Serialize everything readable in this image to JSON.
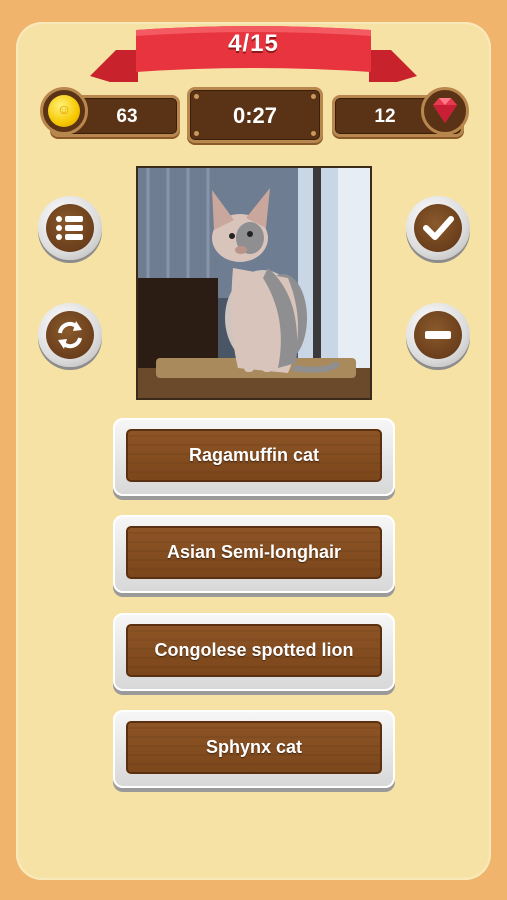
{
  "header": {
    "progress": "4/15"
  },
  "stats": {
    "coins": "63",
    "timer": "0:27",
    "gems": "12"
  },
  "answers": [
    {
      "label": "Ragamuffin cat"
    },
    {
      "label": "Asian Semi-longhair"
    },
    {
      "label": "Congolese spotted lion"
    },
    {
      "label": "Sphynx cat"
    }
  ],
  "colors": {
    "background": "#f0b46c",
    "panel": "#f7e2a6",
    "ribbon": "#e0303a",
    "wood": "#7b461b"
  },
  "icons": {
    "left_top": "list-icon",
    "left_bottom": "refresh-icon",
    "right_top": "check-icon",
    "right_bottom": "minus-icon",
    "coin": "coin-icon",
    "gem": "gem-icon"
  }
}
